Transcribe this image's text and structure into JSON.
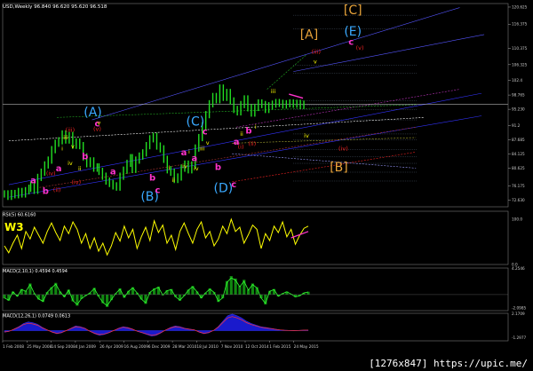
{
  "header": {
    "main": "USD,Weekly  96.840 96.620 95.620 96.518",
    "rsi": "RSI(5) 60.6160",
    "macd1": "MACD(2,10,1) 0.4594 0.4594",
    "macd2": "MACD(12,26,1) 0.0749 0.0613"
  },
  "watermark": "[1276x847] https://upic.me/",
  "colors": {
    "bg": "#000000",
    "price": "#22dd22",
    "cyan": "#3aa9ff",
    "magenta": "#ff33cc",
    "red": "#ee2222",
    "orange": "#e8a33a",
    "yellow": "#ffff00",
    "blue": "#3333ff"
  },
  "chart_data": [
    {
      "type": "line",
      "title": "",
      "xlabel": "",
      "ylabel": "",
      "x_ticks": [
        "1 Feb 2008",
        "25 May 2008",
        "14 Sep 2008",
        "4 Jan 2009",
        "26 Apr 2009",
        "16 Aug 2009",
        "6 Dec 2009",
        "28 Mar 2010",
        "18 Jul 2010",
        "7 Nov 2010",
        "12 Oct 2014",
        "1 Feb 2015",
        "24 May 2015"
      ],
      "y_ticks": [
        "120.625",
        "116.375",
        "110.375",
        "106.325",
        "102.4",
        "98.765",
        "95.230",
        "91.2",
        "87.685",
        "84.125",
        "80.625",
        "76.175",
        "72.630"
      ],
      "ylim": [
        71.0,
        121.5
      ],
      "series": [
        {
          "x": [
            0,
            4,
            8,
            12,
            16,
            20,
            24,
            28,
            30,
            34,
            38,
            42,
            46,
            50,
            54,
            58,
            62,
            66,
            70,
            74,
            78,
            82,
            86,
            90,
            94,
            98,
            102,
            106,
            108,
            112,
            116,
            120,
            124,
            128,
            132,
            136,
            140,
            144,
            146,
            150,
            154,
            158,
            162,
            166,
            170,
            174,
            178,
            182,
            186,
            190,
            194,
            198,
            202,
            206,
            210,
            214,
            218,
            222,
            226,
            230,
            234,
            238,
            242,
            246,
            250,
            254,
            258,
            262,
            266,
            270,
            274,
            278,
            282,
            286,
            290,
            294,
            298,
            302,
            306,
            310,
            314,
            318,
            322,
            326,
            330,
            334,
            338,
            342
          ],
          "values": [
            74.2,
            73.6,
            74.3,
            74.0,
            74.8,
            74.2,
            75.0,
            75.6,
            76.4,
            75.1,
            78.3,
            79.6,
            81.4,
            82.6,
            85.2,
            86.8,
            87.4,
            89.1,
            87.6,
            88.7,
            86.3,
            87.1,
            86.2,
            83.4,
            81.7,
            82.4,
            80.6,
            80.9,
            79.8,
            78.6,
            77.4,
            76.8,
            76.2,
            75.9,
            78.6,
            80.1,
            81.8,
            83.2,
            80.3,
            82.6,
            83.6,
            84.4,
            86.2,
            87.9,
            88.5,
            86.1,
            85.4,
            82.8,
            80.2,
            79.6,
            77.8,
            78.4,
            80.6,
            81.6,
            80.2,
            81.4,
            85.6,
            88.2,
            91.1,
            93.9,
            96.6,
            98.4,
            97.6,
            100.5,
            98.2,
            99.4,
            97.3,
            95.2,
            94.6,
            96.4,
            97.8,
            95.6,
            94.3,
            95.7,
            96.8,
            96.4,
            95.2,
            96.1,
            96.5,
            96.9,
            96.7,
            96.3,
            96.6,
            96.8,
            96.5,
            96.7,
            96.2,
            96.5
          ]
        }
      ]
    },
    {
      "type": "line",
      "title": "RSI(5)",
      "ylim": [
        0,
        100
      ],
      "series": [
        {
          "values": [
            35,
            22,
            40,
            55,
            30,
            62,
            48,
            70,
            55,
            40,
            62,
            78,
            60,
            45,
            72,
            58,
            80,
            66,
            40,
            58,
            30,
            50,
            25,
            40,
            18,
            35,
            60,
            44,
            72,
            50,
            66,
            30,
            52,
            70,
            45,
            82,
            60,
            74,
            40,
            55,
            28,
            62,
            78,
            58,
            40,
            66,
            80,
            50,
            62,
            35,
            48,
            72,
            58,
            85,
            62,
            70,
            40,
            56,
            74,
            66,
            30,
            58,
            45,
            72,
            60,
            80,
            52,
            66,
            38,
            55,
            68,
            72
          ]
        }
      ]
    },
    {
      "type": "bar",
      "title": "MACD(2,10,1)",
      "ylim": [
        -2.6,
        4.3
      ],
      "series": [
        {
          "values": [
            -0.6,
            -1.0,
            0.5,
            -0.3,
            0.9,
            0.6,
            1.8,
            0.2,
            -0.8,
            -1.2,
            0.4,
            1.2,
            1.9,
            0.5,
            -0.4,
            0.8,
            -1.1,
            -1.8,
            -0.7,
            -0.2,
            0.3,
            1.1,
            -0.3,
            -1.4,
            -2.0,
            -0.9,
            0.2,
            1.0,
            -0.5,
            0.6,
            1.2,
            0.3,
            -0.8,
            -1.5,
            0.4,
            1.0,
            1.3,
            -0.1,
            0.7,
            0.9,
            -0.4,
            -1.0,
            -0.2,
            0.8,
            1.4,
            0.5,
            -0.6,
            0.3,
            1.0,
            0.4,
            -1.2,
            -0.6,
            2.2,
            3.0,
            2.6,
            1.4,
            2.4,
            0.8,
            1.8,
            1.2,
            -0.6,
            -1.6,
            0.6,
            0.9,
            -0.3,
            0.2,
            0.5,
            0.1,
            -0.4,
            -0.2,
            0.3,
            0.46
          ]
        }
      ]
    },
    {
      "type": "area",
      "title": "MACD(12,26,1)",
      "ylim": [
        -1.3,
        2.2
      ],
      "series": [
        {
          "values": [
            -0.2,
            -0.1,
            0.2,
            0.5,
            0.9,
            1.1,
            1.0,
            0.8,
            0.4,
            0.1,
            -0.2,
            -0.4,
            -0.3,
            0.0,
            0.3,
            0.6,
            0.5,
            0.3,
            -0.1,
            -0.4,
            -0.6,
            -0.5,
            -0.3,
            0.0,
            0.3,
            0.5,
            0.4,
            0.2,
            -0.1,
            -0.3,
            -0.5,
            -0.7,
            -0.6,
            -0.3,
            0.1,
            0.4,
            0.6,
            0.5,
            0.3,
            0.2,
            0.1,
            -0.2,
            -0.4,
            -0.3,
            0.0,
            0.5,
            1.2,
            1.9,
            2.1,
            1.9,
            1.6,
            1.2,
            0.9,
            0.7,
            0.5,
            0.4,
            0.3,
            0.2,
            0.1,
            0.05,
            0.02,
            0.0,
            0.03,
            0.06,
            0.07
          ]
        }
      ]
    }
  ],
  "annotations": {
    "cyan": [
      {
        "t": "(A)",
        "x": 101,
        "y": 93.5
      },
      {
        "t": "(B)",
        "x": 166,
        "y": 72.5
      },
      {
        "t": "(C)",
        "x": 218,
        "y": 91.2
      },
      {
        "t": "(D)",
        "x": 250,
        "y": 74.6
      },
      {
        "t": "(E)",
        "x": 398,
        "y": 113.6
      }
    ],
    "orange": [
      {
        "t": "[A]",
        "x": 348,
        "y": 112.8
      },
      {
        "t": "[C]",
        "x": 398,
        "y": 118.8
      },
      {
        "t": "[B]",
        "x": 382,
        "y": 79.8
      }
    ],
    "magenta": [
      {
        "t": "c",
        "x": 106,
        "y": 91.0
      },
      {
        "t": "c",
        "x": 229,
        "y": 89.0
      },
      {
        "t": "c",
        "x": 396,
        "y": 111.2
      },
      {
        "t": "a",
        "x": 33,
        "y": 76.8
      },
      {
        "t": "a",
        "x": 124,
        "y": 79.0
      },
      {
        "t": "a",
        "x": 205,
        "y": 83.8
      },
      {
        "t": "a",
        "x": 265,
        "y": 86.4
      },
      {
        "t": "b",
        "x": 47,
        "y": 74.2
      },
      {
        "t": "b",
        "x": 169,
        "y": 77.5
      },
      {
        "t": "b",
        "x": 244,
        "y": 80.2
      },
      {
        "t": "c",
        "x": 175,
        "y": 74.4
      },
      {
        "t": "c",
        "x": 262,
        "y": 75.8
      },
      {
        "t": "a",
        "x": 62,
        "y": 79.8
      },
      {
        "t": "b",
        "x": 92,
        "y": 82.8
      },
      {
        "t": "b",
        "x": 279,
        "y": 89.2
      },
      {
        "t": "a",
        "x": 217,
        "y": 82.4
      }
    ],
    "red": [
      {
        "t": "(iii)",
        "x": 75,
        "y": 89.6
      },
      {
        "t": "(iv)",
        "x": 53,
        "y": 78.8
      },
      {
        "t": "(ii)",
        "x": 60,
        "y": 74.8
      },
      {
        "t": "(iv)",
        "x": 82,
        "y": 76.6
      },
      {
        "t": "(iii)",
        "x": 356,
        "y": 109.0
      },
      {
        "t": "(v)",
        "x": 406,
        "y": 110.0
      },
      {
        "t": "(iv)",
        "x": 387,
        "y": 85.0
      },
      {
        "t": "(v)",
        "x": 106,
        "y": 89.8
      },
      {
        "t": "(i)",
        "x": 270,
        "y": 85.4
      },
      {
        "t": "(ii)",
        "x": 283,
        "y": 86.2
      }
    ],
    "yellow": [
      {
        "t": "iii",
        "x": 70,
        "y": 87.8
      },
      {
        "t": "iv",
        "x": 75,
        "y": 81.4
      },
      {
        "t": "v",
        "x": 78,
        "y": 85.6
      },
      {
        "t": "iii",
        "x": 307,
        "y": 99.2
      },
      {
        "t": "iv",
        "x": 345,
        "y": 88.2
      },
      {
        "t": "v",
        "x": 355,
        "y": 106.6
      },
      {
        "t": "v",
        "x": 108,
        "y": 91.4
      },
      {
        "t": "iv",
        "x": 206,
        "y": 80.6
      },
      {
        "t": "ii",
        "x": 193,
        "y": 77.2
      },
      {
        "t": "iii",
        "x": 226,
        "y": 85.0
      },
      {
        "t": "v",
        "x": 232,
        "y": 86.4
      },
      {
        "t": "ii",
        "x": 86,
        "y": 80.0
      },
      {
        "t": "iv",
        "x": 219,
        "y": 80.0
      },
      {
        "t": "ii",
        "x": 271,
        "y": 88.6
      },
      {
        "t": "i",
        "x": 287,
        "y": 90.4
      },
      {
        "t": "i",
        "x": 66,
        "y": 85.0
      },
      {
        "t": "i",
        "x": 188,
        "y": 80.2
      },
      {
        "t": "i",
        "x": 211,
        "y": 84.2
      }
    ]
  }
}
